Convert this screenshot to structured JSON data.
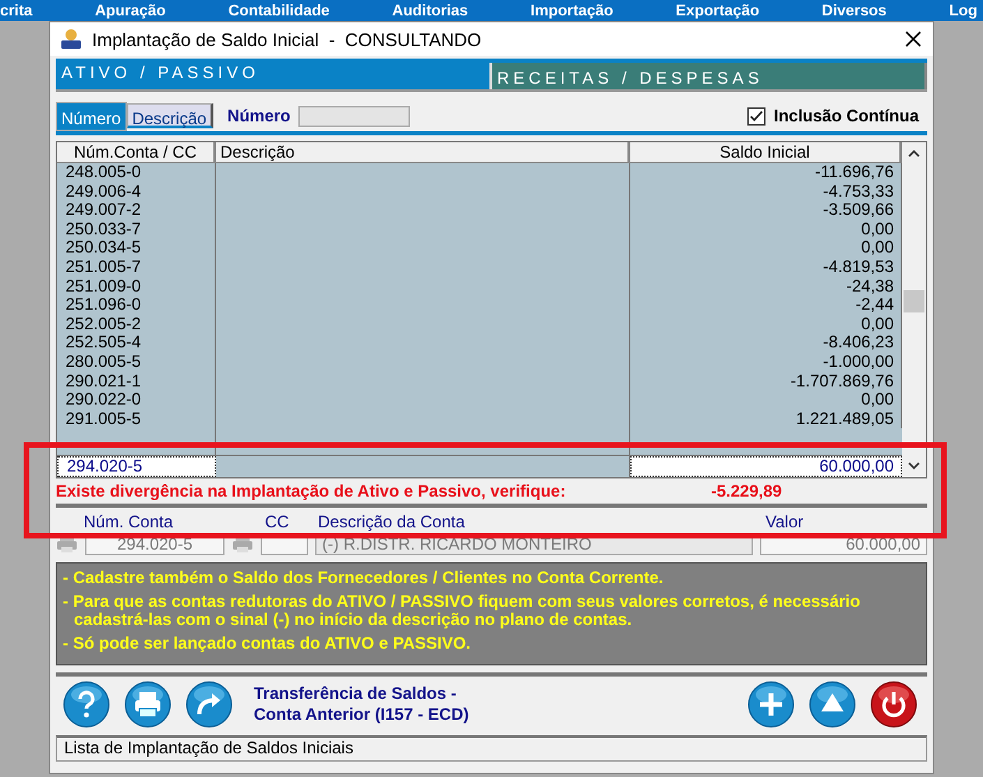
{
  "menu_bar": [
    "crita",
    "Apuração",
    "Contabilidade",
    "Auditorias",
    "Importação",
    "Exportação",
    "Diversos",
    "Log"
  ],
  "window": {
    "title": "Implantação de Saldo Inicial  -  CONSULTANDO"
  },
  "main_tabs": [
    {
      "label": "ATIVO / PASSIVO",
      "selected": true
    },
    {
      "label": "RECEITAS / DESPESAS",
      "selected": false
    }
  ],
  "search_tabs": [
    {
      "label": "Número",
      "selected": true
    },
    {
      "label": "Descrição",
      "selected": false
    }
  ],
  "search": {
    "label": "Número"
  },
  "continuous_inclusion": {
    "label": "Inclusão Contínua",
    "checked": true
  },
  "table": {
    "columns": [
      "Núm.Conta / CC",
      "Descrição",
      "Saldo Inicial"
    ],
    "rows": [
      {
        "account": "248.005-0",
        "balance": "-11.696,76"
      },
      {
        "account": "249.006-4",
        "balance": "-4.753,33"
      },
      {
        "account": "249.007-2",
        "balance": "-3.509,66"
      },
      {
        "account": "250.033-7",
        "balance": "0,00"
      },
      {
        "account": "250.034-5",
        "balance": "0,00"
      },
      {
        "account": "251.005-7",
        "balance": "-4.819,53"
      },
      {
        "account": "251.009-0",
        "balance": "-24,38"
      },
      {
        "account": "251.096-0",
        "balance": "-2,44"
      },
      {
        "account": "252.005-2",
        "balance": "0,00"
      },
      {
        "account": "252.505-4",
        "balance": "-8.406,23"
      },
      {
        "account": "280.005-5",
        "balance": "-1.000,00"
      },
      {
        "account": "290.021-1",
        "balance": "-1.707.869,76"
      },
      {
        "account": "290.022-0",
        "balance": "0,00"
      },
      {
        "account": "291.005-5",
        "balance": "1.221.489,05"
      }
    ],
    "edit_row": {
      "account": "294.020-5",
      "balance": "60.000,00"
    }
  },
  "divergence": {
    "message": "Existe divergência na Implantação de Ativo e Passivo, verifique:",
    "value": "-5.229,89"
  },
  "entry": {
    "labels": [
      "Núm. Conta",
      "CC",
      "Descrição da Conta",
      "Valor"
    ],
    "account": "294.020-5",
    "description": "(-) R.DISTR. RICARDO MONTEIRO",
    "value": "60.000,00",
    "disabled": true
  },
  "notes": [
    "- Cadastre também o Saldo dos Fornecedores / Clientes no Conta Corrente.",
    "- Para que as contas redutoras do ATIVO / PASSIVO fiquem com seus valores corretos, é necessário cadastrá-las com o sinal (-) no início da descrição no plano de contas.",
    "- Só pode ser lançado contas do ATIVO e PASSIVO."
  ],
  "toolbar_left": [
    {
      "kind": "help"
    },
    {
      "kind": "print"
    },
    {
      "kind": "redo"
    }
  ],
  "transfer_link": "Transferência de Saldos - Conta Anterior (I157 - ECD)",
  "toolbar_right": [
    {
      "kind": "add"
    },
    {
      "kind": "up"
    },
    {
      "kind": "power"
    }
  ],
  "status_bar": "Lista de Implantação de Saldos Iniciais",
  "highlight_frame": true
}
